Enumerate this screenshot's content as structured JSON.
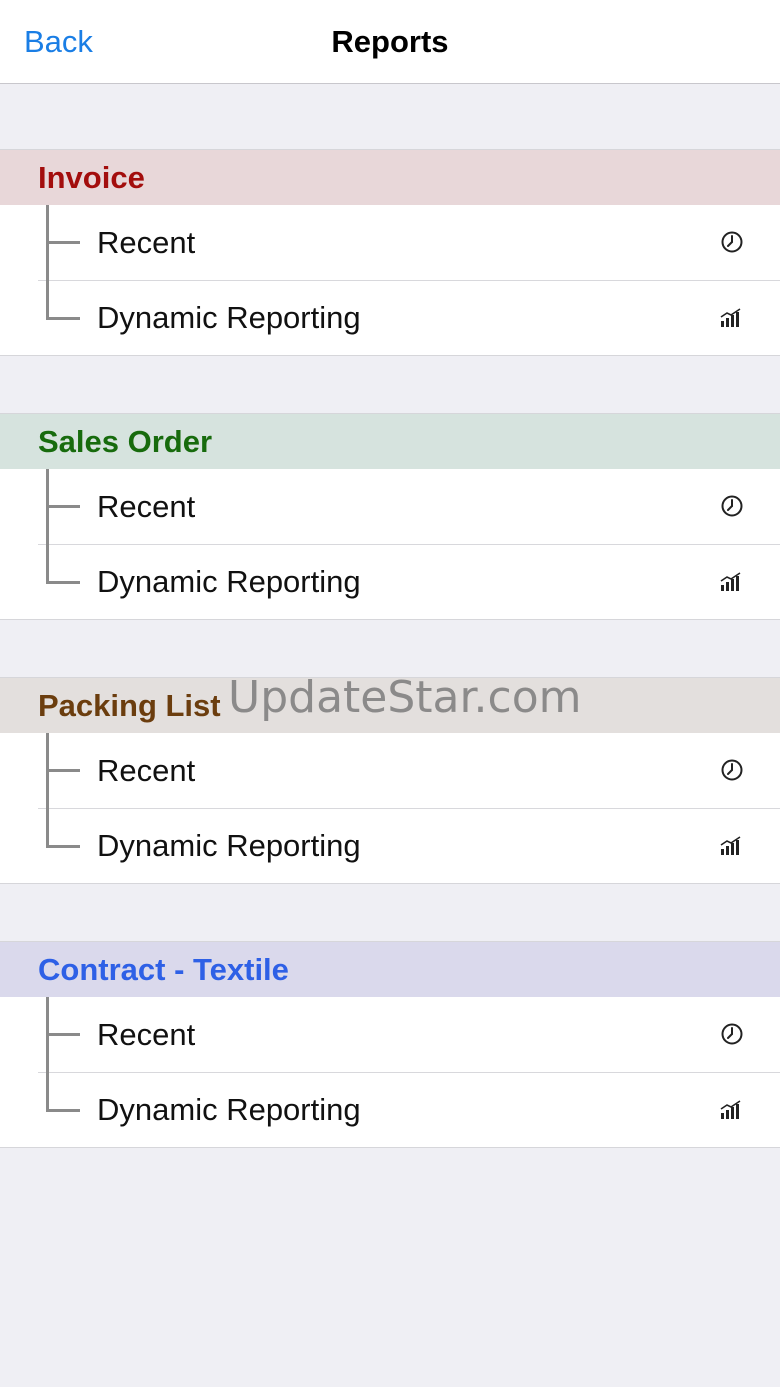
{
  "navbar": {
    "back_label": "Back",
    "title": "Reports"
  },
  "sections": [
    {
      "title": "Invoice",
      "title_color": "#a30d0d",
      "header_bg": "#e8d7d9",
      "rows": [
        {
          "label": "Recent",
          "icon": "clock-icon"
        },
        {
          "label": "Dynamic Reporting",
          "icon": "signal-bars-icon"
        }
      ]
    },
    {
      "title": "Sales Order",
      "title_color": "#176b0d",
      "header_bg": "#d6e3de",
      "rows": [
        {
          "label": "Recent",
          "icon": "clock-icon"
        },
        {
          "label": "Dynamic Reporting",
          "icon": "signal-bars-icon"
        }
      ]
    },
    {
      "title": "Packing List",
      "title_color": "#6b3d0e",
      "header_bg": "#e3dfdd",
      "rows": [
        {
          "label": "Recent",
          "icon": "clock-icon"
        },
        {
          "label": "Dynamic Reporting",
          "icon": "signal-bars-icon"
        }
      ]
    },
    {
      "title": "Contract - Textile",
      "title_color": "#2e60e6",
      "header_bg": "#dad9ec",
      "rows": [
        {
          "label": "Recent",
          "icon": "clock-icon"
        },
        {
          "label": "Dynamic Reporting",
          "icon": "signal-bars-icon"
        }
      ]
    }
  ],
  "watermark": "UpdateStar.com"
}
